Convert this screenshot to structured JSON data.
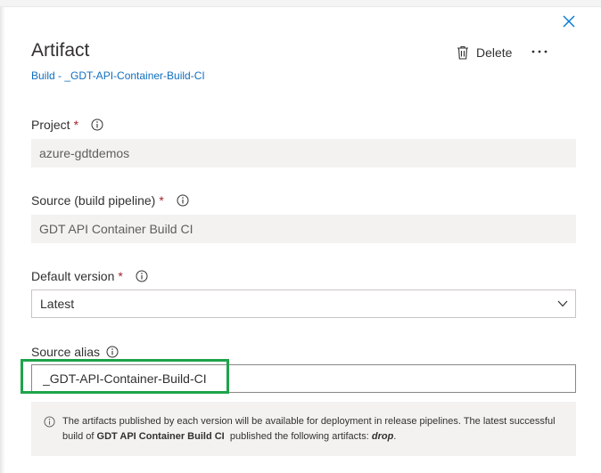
{
  "panel": {
    "title": "Artifact",
    "subtitle": "Build - _GDT-API-Container-Build-CI",
    "delete_label": "Delete"
  },
  "fields": {
    "project": {
      "label": "Project",
      "value": "azure-gdtdemos"
    },
    "source": {
      "label": "Source (build pipeline)",
      "value": "GDT API Container Build CI"
    },
    "default_version": {
      "label": "Default version",
      "value": "Latest"
    },
    "source_alias": {
      "label": "Source alias",
      "value": "_GDT-API-Container-Build-CI"
    },
    "required_marker": "*"
  },
  "info_message": {
    "prefix": "The artifacts published by each version will be available for deployment in release pipelines. The latest successful build of ",
    "pipeline_name": "GDT API Container Build CI",
    "middle": "  published the following artifacts: ",
    "artifact_name": "drop",
    "suffix": "."
  },
  "icons": {
    "close": "close-icon",
    "delete": "trash-icon",
    "more": "more-icon",
    "info": "info-icon",
    "dropdown": "chevron-down-icon"
  },
  "colors": {
    "link": "#106ebe",
    "highlight": "#1ea44a",
    "required": "#a4262c",
    "readonly_bg": "#f3f2f1"
  }
}
